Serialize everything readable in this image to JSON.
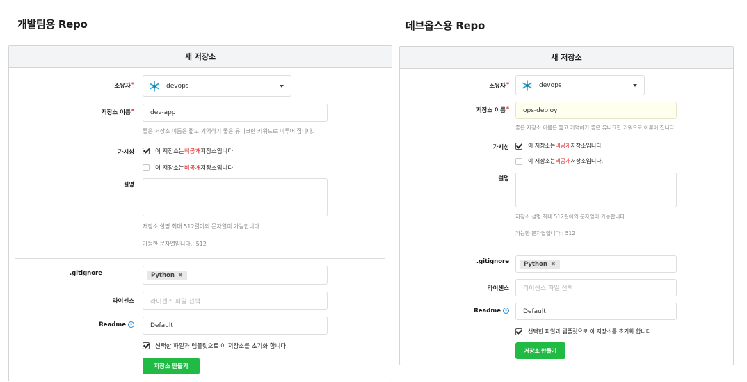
{
  "left": {
    "title": "개발팀용 Repo",
    "form": {
      "header": "새 저장소",
      "owner": {
        "label": "소유자",
        "required": "*",
        "value": "devops"
      },
      "name": {
        "label": "저장소 이름",
        "required": "*",
        "value": "dev-app",
        "help": "좋은 저장소 이름은 짧고 기억하기 좋은 유니크한 키워드로 이루어 집니다."
      },
      "visibility": {
        "label": "가시성",
        "option1": {
          "prefix": "이 저장소는 ",
          "highlight": "비공개",
          "suffix": " 저장소입니다",
          "checked": true
        },
        "option2": {
          "prefix": "이 저장소는 ",
          "highlight": "비공개",
          "suffix": " 저장소입니다.",
          "checked": false
        }
      },
      "description": {
        "label": "설명",
        "help": "저장소 설명.최대 512길이의 문자열이 가능합니다.",
        "remaining": "가능한 문자열입니다.: 512"
      },
      "gitignore": {
        "label": ".gitignore",
        "tag": "Python",
        "remove": "✖"
      },
      "license": {
        "label": "라이센스",
        "placeholder": "라이센스 파일 선택"
      },
      "readme": {
        "label": "Readme",
        "help_icon": "?",
        "value": "Default"
      },
      "init": {
        "label": "선택한 파일과 템플릿으로 이 저장소를 초기화 합니다.",
        "checked": true
      },
      "submit": "저장소 만들기"
    }
  },
  "right": {
    "title": "데브옵스용 Repo",
    "form": {
      "header": "새 저장소",
      "owner": {
        "label": "소유자",
        "required": "*",
        "value": "devops"
      },
      "name": {
        "label": "저장소 이름",
        "required": "*",
        "value": "ops-deploy",
        "help": "좋은 저장소 이름은 짧고 기억하기 좋은 유니크한 키워드로 이루어 집니다."
      },
      "visibility": {
        "label": "가시성",
        "option1": {
          "prefix": "이 저장소는 ",
          "highlight": "비공개",
          "suffix": " 저장소입니다",
          "checked": true
        },
        "option2": {
          "prefix": "이 저장소는 ",
          "highlight": "비공개",
          "suffix": " 저장소입니다.",
          "checked": false
        }
      },
      "description": {
        "label": "설명",
        "help": "저장소 설명.최대 512길이의 문자열이 가능합니다.",
        "remaining": "가능한 문자열입니다.: 512"
      },
      "gitignore": {
        "label": ".gitignore",
        "tag": "Python",
        "remove": "✖"
      },
      "license": {
        "label": "라이센스",
        "placeholder": "라이센스 파일 선택"
      },
      "readme": {
        "label": "Readme",
        "help_icon": "?",
        "value": "Default"
      },
      "init": {
        "label": "선택한 파일과 템플릿으로 이 저장소를 초기화 합니다.",
        "checked": true
      },
      "submit": "저장소 만들기"
    }
  },
  "colors": {
    "accent_red": "#db2828",
    "button_green": "#21ba45",
    "help_blue": "#2185d0",
    "warn_bg": "#fffff0"
  },
  "icons": {
    "owner_avatar": "snowflake-avatar-icon",
    "dropdown": "caret-down-icon",
    "check": "checkmark-icon",
    "help": "question-circle-icon"
  }
}
